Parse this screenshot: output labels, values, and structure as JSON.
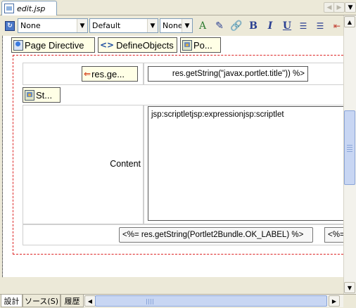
{
  "tab": {
    "title": "edit.jsp",
    "icon": "jsp-file-icon"
  },
  "toolbar": {
    "style_combo": "None",
    "font_combo": "Default",
    "size_combo": "None",
    "bold": "B",
    "italic": "I",
    "underline": "U"
  },
  "palette": {
    "page_directive": "Page Directive",
    "define_objects": "DefineObjects",
    "po": "Po..."
  },
  "form": {
    "title_label_button": "res.ge...",
    "title_value": "res.getString(\"javax.portlet.title\")) %>",
    "script_button": "St...",
    "content_label": "Content",
    "content_value": "jsp:scriptletjsp:expressionjsp:scriptlet",
    "ok_button": "<%= res.getString(Portlet2Bundle.OK_LABEL) %>",
    "next_button": "<%="
  },
  "bottom_tabs": [
    "設計",
    "ソース(S)",
    "履歴"
  ]
}
